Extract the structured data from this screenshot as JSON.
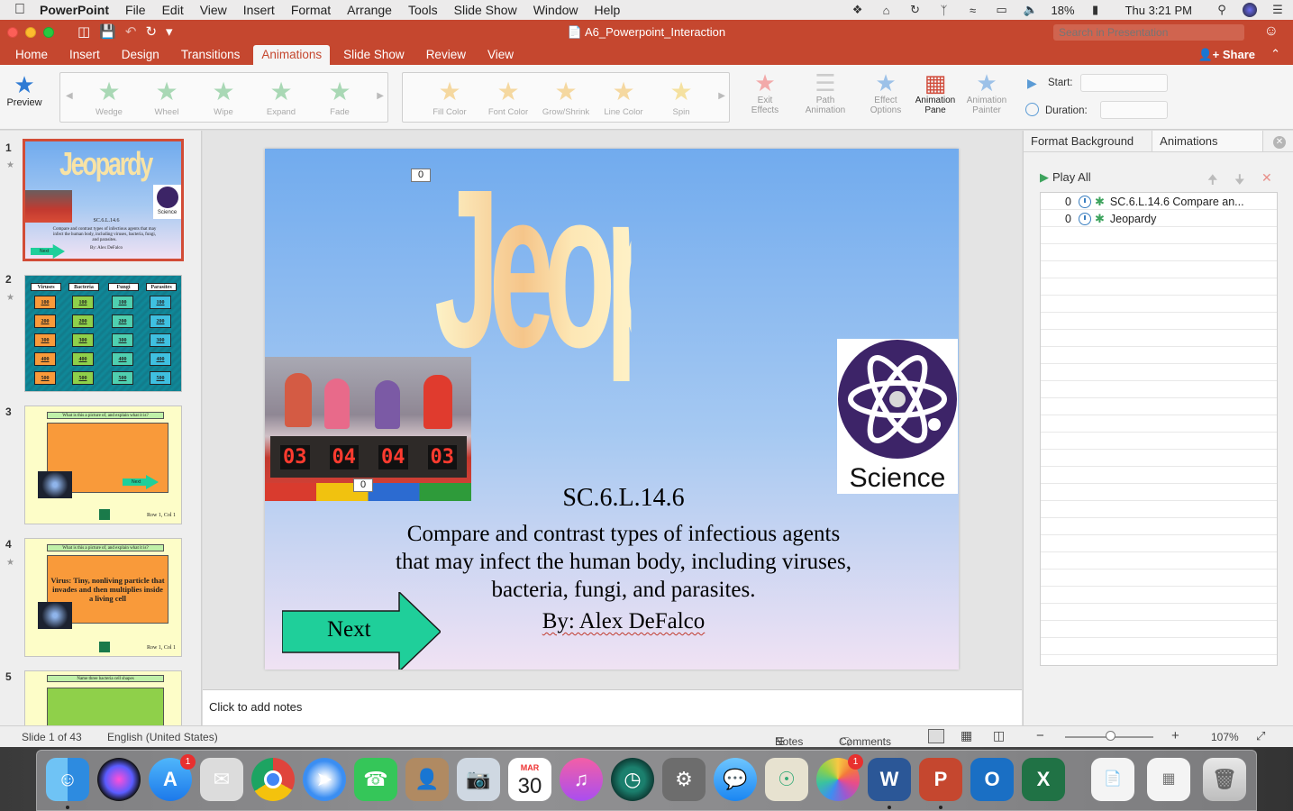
{
  "menubar": {
    "app_name": "PowerPoint",
    "items": [
      "File",
      "Edit",
      "View",
      "Insert",
      "Format",
      "Arrange",
      "Tools",
      "Slide Show",
      "Window",
      "Help"
    ],
    "battery": "18%",
    "clock": "Thu 3:21 PM"
  },
  "titlebar": {
    "document_title": "A6_Powerpoint_Interaction",
    "search_placeholder": "Search in Presentation"
  },
  "ribbon_tabs": {
    "items": [
      "Home",
      "Insert",
      "Design",
      "Transitions",
      "Animations",
      "Slide Show",
      "Review",
      "View"
    ],
    "active": "Animations",
    "share_label": "Share"
  },
  "ribbon": {
    "preview_label": "Preview",
    "entrance": [
      "Wedge",
      "Wheel",
      "Wipe",
      "Expand",
      "Fade"
    ],
    "emphasis": [
      "Fill Color",
      "Font Color",
      "Grow/Shrink",
      "Line Color",
      "Spin"
    ],
    "exit_label_1": "Exit",
    "exit_label_2": "Effects",
    "path_label_1": "Path",
    "path_label_2": "Animation",
    "effect_label_1": "Effect",
    "effect_label_2": "Options",
    "pane_label_1": "Animation",
    "pane_label_2": "Pane",
    "painter_label_1": "Animation",
    "painter_label_2": "Painter",
    "start_label": "Start:",
    "duration_label": "Duration:"
  },
  "thumbnails": {
    "numbers": [
      "1",
      "2",
      "3",
      "4",
      "5"
    ],
    "slide1": {
      "title": "Jeopardy",
      "code": "SC.6.L.14.6",
      "desc": "Compare and contrast types of infectious agents that may infect the human body, including viruses, bacteria, fungi, and parasites.",
      "author": "By: Alex DeFalco",
      "next": "Next",
      "science": "Science"
    },
    "slide2": {
      "headers": [
        "Viruses",
        "Bacteria",
        "Fungi",
        "Parasites"
      ],
      "values": [
        "100",
        "200",
        "300",
        "400",
        "500"
      ]
    },
    "slide3": {
      "question": "What is this a picture of, and explain what it is?",
      "next": "Next",
      "rowcol": "Row 1, Col 1"
    },
    "slide4": {
      "question": "What is this a picture of, and explain what it is?",
      "answer": "Virus: Tiny, nonliving particle that invades and then multiplies inside a living cell",
      "rowcol": "Row 1, Col 1"
    },
    "slide5": {
      "question": "Name three bacteria cell shapes"
    }
  },
  "slide": {
    "title": "Jeopardy",
    "marker_top": "0",
    "marker_photo": "0",
    "code": "SC.6.L.14.6",
    "desc_line1": "Compare and contrast types of infectious agents",
    "desc_line2": "that may infect the human body, including viruses,",
    "desc_line3": "bacteria, fungi, and parasites.",
    "author": "By: Alex DeFalco",
    "next": "Next",
    "science": "Science",
    "scoreboard": [
      "03",
      "04",
      "04",
      "03"
    ]
  },
  "notes": {
    "placeholder": "Click to add notes"
  },
  "pane": {
    "tab_format": "Format Background",
    "tab_animations": "Animations",
    "play_all": "Play All",
    "animations": [
      {
        "order": "0",
        "name": "SC.6.L.14.6 Compare an..."
      },
      {
        "order": "0",
        "name": "Jeopardy"
      }
    ]
  },
  "status": {
    "slide_info": "Slide 1 of 43",
    "language": "English (United States)",
    "notes": "Notes",
    "comments": "Comments",
    "zoom": "107%"
  },
  "dock": {
    "word_label": "W",
    "ppt_label": "P",
    "outlook_label": "O",
    "excel_label": "X",
    "badge_appstore": "1",
    "badge_photos": "1",
    "calendar_month": "MAR",
    "calendar_day": "30"
  },
  "colors": {
    "ppt_accent": "#c5472f",
    "next_arrow": "#1fcf9a",
    "selection": "#d24c36"
  }
}
